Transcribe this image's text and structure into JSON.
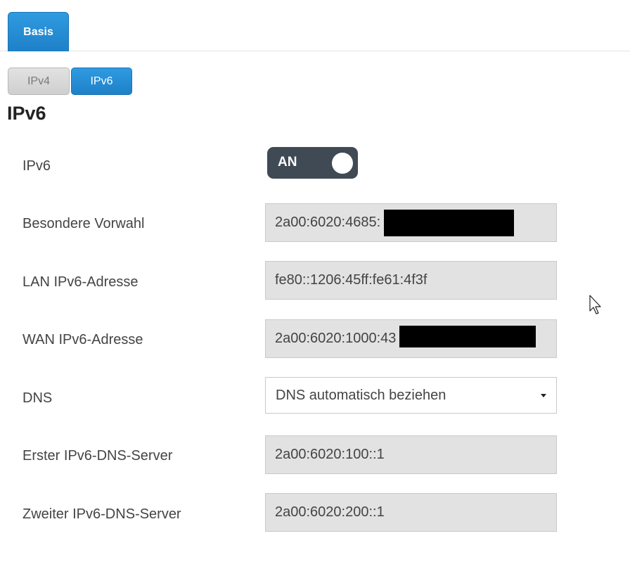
{
  "tabs": {
    "basis": "Basis"
  },
  "subtabs": {
    "ipv4": "IPv4",
    "ipv6": "IPv6"
  },
  "section": {
    "title": "IPv6"
  },
  "rows": {
    "ipv6": {
      "label": "IPv6",
      "toggle_text": "AN",
      "enabled": true
    },
    "prefix": {
      "label": "Besondere Vorwahl",
      "value": "2a00:6020:4685:"
    },
    "lan": {
      "label": "LAN IPv6-Adresse",
      "value": "fe80::1206:45ff:fe61:4f3f"
    },
    "wan": {
      "label": "WAN IPv6-Adresse",
      "value": "2a00:6020:1000:43"
    },
    "dns": {
      "label": "DNS",
      "selected": "DNS automatisch beziehen"
    },
    "dns1": {
      "label": "Erster IPv6-DNS-Server",
      "value": "2a00:6020:100::1"
    },
    "dns2": {
      "label": "Zweiter IPv6-DNS-Server",
      "value": "2a00:6020:200::1"
    }
  },
  "colors": {
    "accent": "#1e80c8",
    "toggle_bg": "#3f4a55",
    "field_bg": "#e2e2e2"
  },
  "icons": {
    "cursor": "mouse-pointer-icon",
    "dropdown": "caret-down-icon"
  }
}
